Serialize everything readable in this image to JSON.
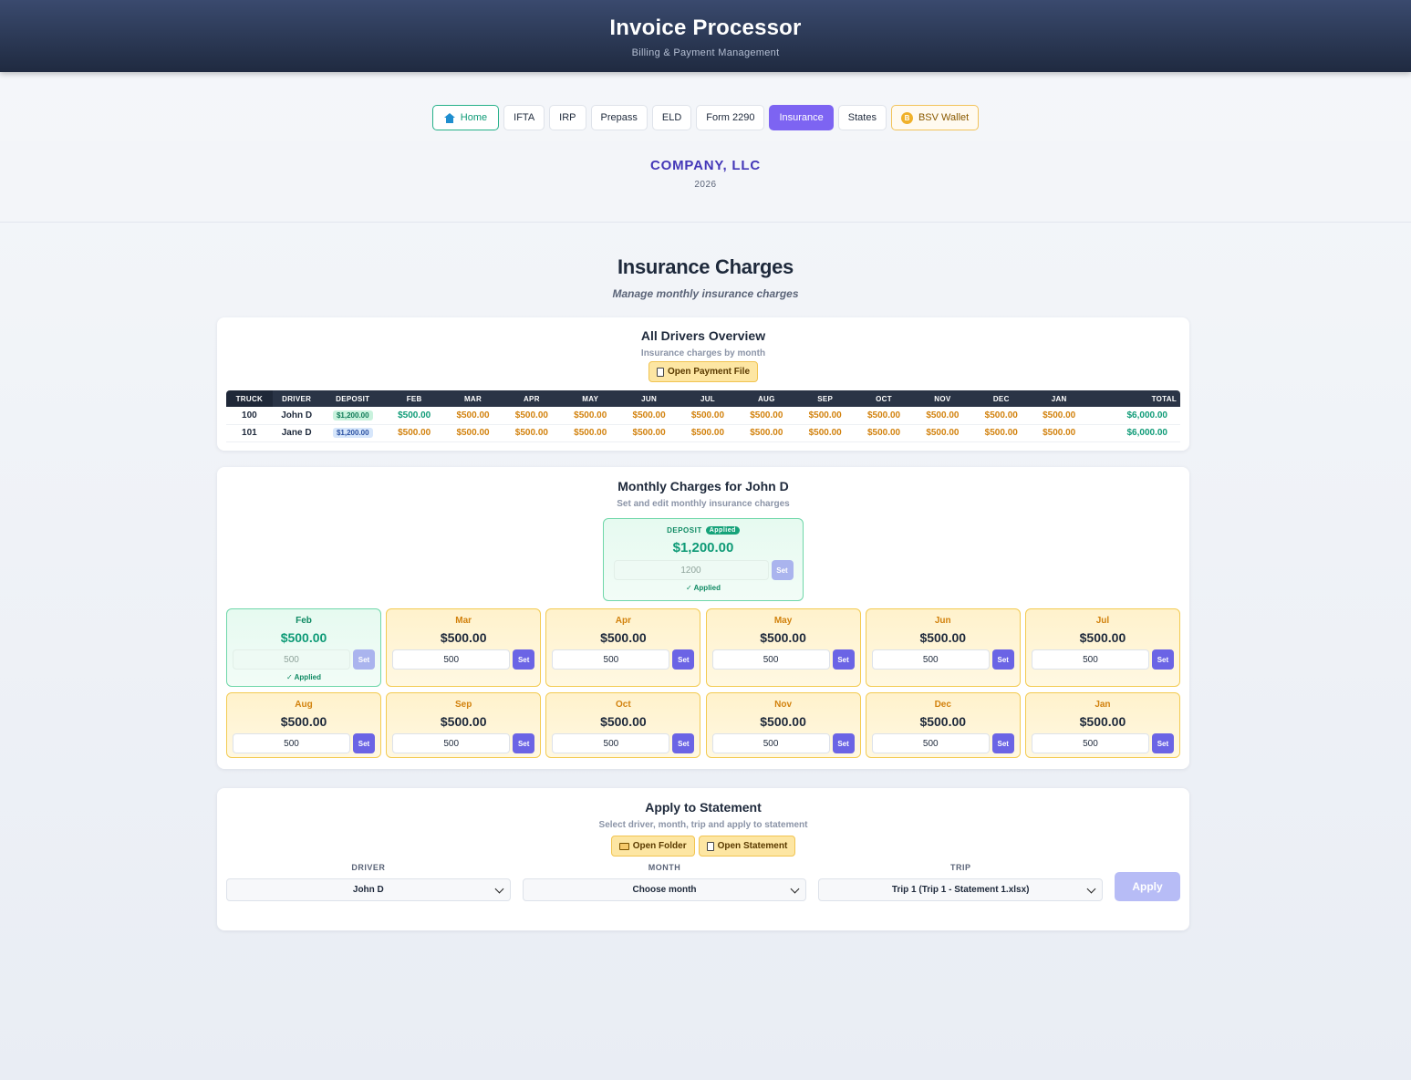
{
  "app": {
    "title": "Invoice Processor",
    "subtitle": "Billing & Payment Management"
  },
  "nav": {
    "home": "Home",
    "items": [
      "IFTA",
      "IRP",
      "Prepass",
      "ELD",
      "Form 2290",
      "Insurance",
      "States"
    ],
    "active": "Insurance",
    "wallet": "BSV Wallet",
    "wallet_icon_glyph": "B"
  },
  "company": {
    "name": "COMPANY, LLC",
    "year": "2026"
  },
  "page": {
    "title": "Insurance Charges",
    "subtitle": "Manage monthly insurance charges"
  },
  "overview": {
    "title": "All Drivers Overview",
    "subtitle": "Insurance charges by month",
    "open_file_label": "Open Payment File",
    "columns": [
      "TRUCK",
      "DRIVER",
      "DEPOSIT",
      "FEB",
      "MAR",
      "APR",
      "MAY",
      "JUN",
      "JUL",
      "AUG",
      "SEP",
      "OCT",
      "NOV",
      "DEC",
      "JAN",
      "TOTAL"
    ],
    "rows": [
      {
        "truck": "100",
        "driver": "John D",
        "deposit": "$1,200.00",
        "months": [
          "$500.00",
          "$500.00",
          "$500.00",
          "$500.00",
          "$500.00",
          "$500.00",
          "$500.00",
          "$500.00",
          "$500.00",
          "$500.00",
          "$500.00",
          "$500.00"
        ],
        "total": "$6,000.00"
      },
      {
        "truck": "101",
        "driver": "Jane D",
        "deposit": "$1,200.00",
        "months": [
          "$500.00",
          "$500.00",
          "$500.00",
          "$500.00",
          "$500.00",
          "$500.00",
          "$500.00",
          "$500.00",
          "$500.00",
          "$500.00",
          "$500.00",
          "$500.00"
        ],
        "total": "$6,000.00"
      }
    ]
  },
  "monthly": {
    "title": "Monthly Charges for John D",
    "subtitle": "Set and edit monthly insurance charges",
    "deposit": {
      "label": "DEPOSIT",
      "badge": "Applied",
      "amount": "$1,200.00",
      "input": "1200",
      "set_label": "Set",
      "note": "✓ Applied"
    },
    "set_label": "Set",
    "applied_note": "✓ Applied",
    "months": [
      {
        "name": "Feb",
        "amount": "$500.00",
        "input": "500",
        "applied": true
      },
      {
        "name": "Mar",
        "amount": "$500.00",
        "input": "500",
        "applied": false
      },
      {
        "name": "Apr",
        "amount": "$500.00",
        "input": "500",
        "applied": false
      },
      {
        "name": "May",
        "amount": "$500.00",
        "input": "500",
        "applied": false
      },
      {
        "name": "Jun",
        "amount": "$500.00",
        "input": "500",
        "applied": false
      },
      {
        "name": "Jul",
        "amount": "$500.00",
        "input": "500",
        "applied": false
      },
      {
        "name": "Aug",
        "amount": "$500.00",
        "input": "500",
        "applied": false
      },
      {
        "name": "Sep",
        "amount": "$500.00",
        "input": "500",
        "applied": false
      },
      {
        "name": "Oct",
        "amount": "$500.00",
        "input": "500",
        "applied": false
      },
      {
        "name": "Nov",
        "amount": "$500.00",
        "input": "500",
        "applied": false
      },
      {
        "name": "Dec",
        "amount": "$500.00",
        "input": "500",
        "applied": false
      },
      {
        "name": "Jan",
        "amount": "$500.00",
        "input": "500",
        "applied": false
      }
    ]
  },
  "apply": {
    "title": "Apply to Statement",
    "subtitle": "Select driver, month, trip and apply to statement",
    "open_folder_label": "Open Folder",
    "open_statement_label": "Open Statement",
    "driver_label": "DRIVER",
    "driver_value": "John D",
    "month_label": "MONTH",
    "month_value": "Choose month",
    "trip_label": "TRIP",
    "trip_value": "Trip 1 (Trip 1 - Statement 1.xlsx)",
    "apply_label": "Apply"
  },
  "colors": {
    "accent": "#7d64f2",
    "applied": "#0f9b77",
    "pending": "#d2820e",
    "header": "#2a3446"
  }
}
